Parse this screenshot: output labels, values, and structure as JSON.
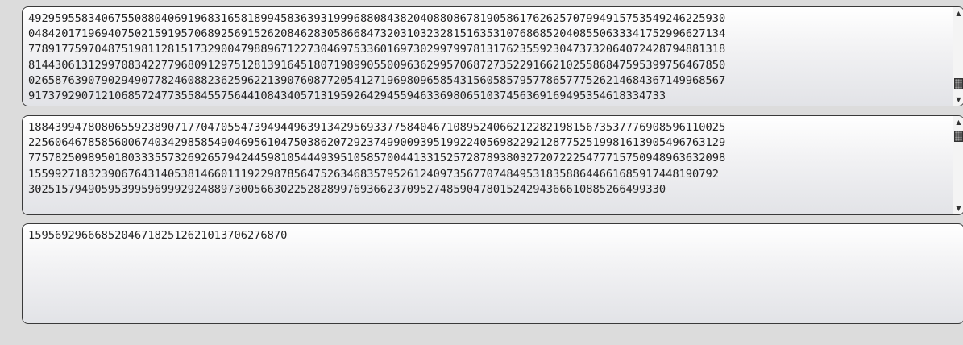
{
  "boxes": [
    {
      "lines": [
        "49295955834067550880406919683165818994583639319996880843820408808678190586176262570799491575354924622593​0",
        "04842017196940750215919570689256915262084628305866847320310323281516353107686852040855063334175299662713​4",
        "77891775970487519811281517329004798896712273046975336016973029979978131762355923047373206407242879488131​8",
        "81443061312997083422779680912975128139164518071989905500963629957068727352291662102558684759539975646785​0",
        "02658763907902949077824608823625962213907608772054127196980965854315605857957786577752621468436714996856​7",
        "917379290712106857247735584557564410843405713195926429455946336980651037456369169495354618334733"
      ],
      "scroll_position": "bottom"
    },
    {
      "lines": [
        "18843994780806559238907177047055473949449639134295693377584046710895240662122821981567353777690859611002​5",
        "22560646785856006740342985854904695610475038620729237499009395199224056982292128775251998161390549676312​9",
        "77578250989501803335573269265794244598105444939510585700441331525728789380327207222547771575094896363209​8",
        "15599271832390676431405381466011192298785647526346835795261240973567707484953183588644661685917448190792",
        "302515794905953995969992924889730056630225282899769366237095274859047801524294366610885266499330"
      ],
      "scroll_position": "top"
    },
    {
      "lines": [
        "159569296668520467182512621013706276870"
      ]
    }
  ],
  "icons": {
    "scroll_up": "scroll-up-arrow-icon",
    "scroll_down": "scroll-down-arrow-icon"
  }
}
